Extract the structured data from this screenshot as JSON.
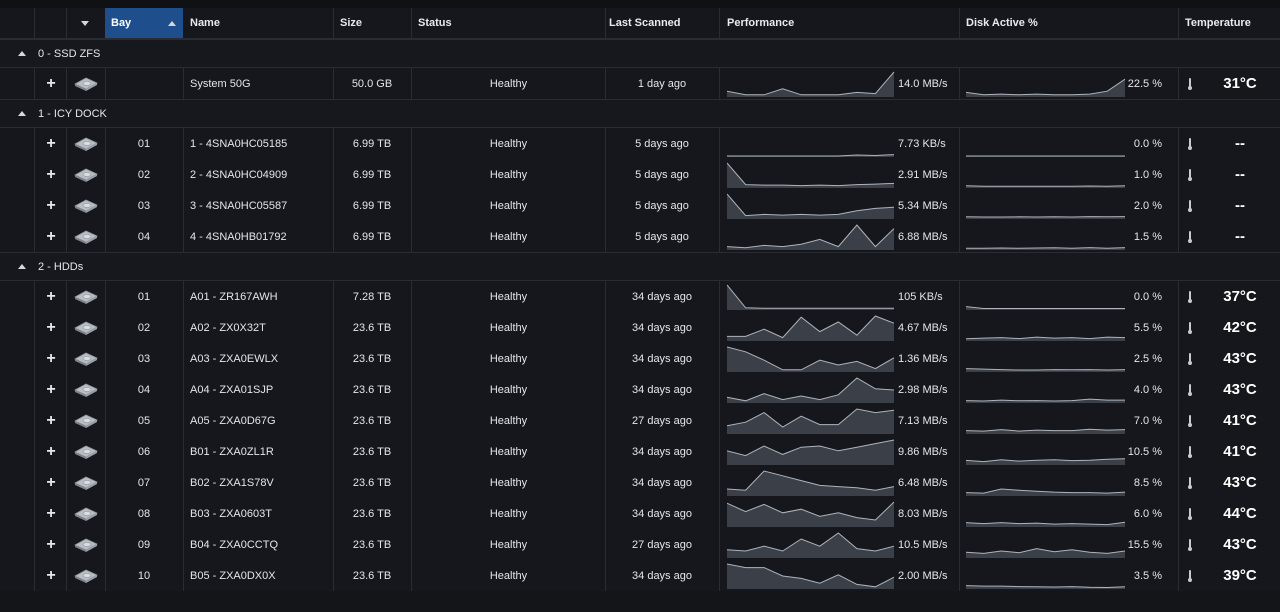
{
  "columns": {
    "bay": "Bay",
    "name": "Name",
    "size": "Size",
    "status": "Status",
    "last_scanned": "Last Scanned",
    "performance": "Performance",
    "disk_active": "Disk Active %",
    "temperature": "Temperature"
  },
  "groups": [
    {
      "label": "0 - SSD ZFS",
      "rows": [
        {
          "bay": "",
          "name": "System 50G",
          "size": "50.0 GB",
          "status": "Healthy",
          "last_scanned": "1 day ago",
          "perf": "14.0 MB/s",
          "active": "22.5 %",
          "temp": "31°C",
          "perf_spark": [
            0.2,
            0.05,
            0.05,
            0.3,
            0.05,
            0.05,
            0.05,
            0.15,
            0.1,
            1.0
          ],
          "active_spark": [
            0.15,
            0.05,
            0.08,
            0.05,
            0.08,
            0.05,
            0.05,
            0.08,
            0.2,
            0.7
          ]
        }
      ]
    },
    {
      "label": "1 - ICY DOCK",
      "rows": [
        {
          "bay": "01",
          "name": "1 - 4SNA0HC05185",
          "size": "6.99 TB",
          "status": "Healthy",
          "last_scanned": "5 days ago",
          "perf": "7.73 KB/s",
          "active": "0.0 %",
          "temp": "--",
          "perf_spark": [
            0,
            0,
            0,
            0,
            0,
            0,
            0,
            0.04,
            0.02,
            0.06
          ],
          "active_spark": [
            0,
            0,
            0,
            0,
            0,
            0,
            0,
            0,
            0,
            0
          ]
        },
        {
          "bay": "02",
          "name": "2 - 4SNA0HC04909",
          "size": "6.99 TB",
          "status": "Healthy",
          "last_scanned": "5 days ago",
          "perf": "2.91 MB/s",
          "active": "1.0 %",
          "temp": "--",
          "perf_spark": [
            1.0,
            0.1,
            0.08,
            0.08,
            0.06,
            0.08,
            0.06,
            0.1,
            0.12,
            0.15
          ],
          "active_spark": [
            0.05,
            0.03,
            0.03,
            0.03,
            0.03,
            0.03,
            0.03,
            0.04,
            0.03,
            0.05
          ]
        },
        {
          "bay": "03",
          "name": "3 - 4SNA0HC05587",
          "size": "6.99 TB",
          "status": "Healthy",
          "last_scanned": "5 days ago",
          "perf": "5.34 MB/s",
          "active": "2.0 %",
          "temp": "--",
          "perf_spark": [
            1.0,
            0.1,
            0.15,
            0.12,
            0.15,
            0.12,
            0.15,
            0.3,
            0.4,
            0.45
          ],
          "active_spark": [
            0.05,
            0.04,
            0.04,
            0.05,
            0.04,
            0.05,
            0.04,
            0.06,
            0.05,
            0.06
          ]
        },
        {
          "bay": "04",
          "name": "4 - 4SNA0HB01792",
          "size": "6.99 TB",
          "status": "Healthy",
          "last_scanned": "5 days ago",
          "perf": "6.88 MB/s",
          "active": "1.5 %",
          "temp": "--",
          "perf_spark": [
            0.1,
            0.05,
            0.15,
            0.1,
            0.2,
            0.4,
            0.1,
            1.0,
            0.1,
            0.85
          ],
          "active_spark": [
            0.03,
            0.03,
            0.04,
            0.03,
            0.04,
            0.05,
            0.03,
            0.06,
            0.03,
            0.06
          ]
        }
      ]
    },
    {
      "label": "2 - HDDs",
      "rows": [
        {
          "bay": "01",
          "name": "A01 - ZR167AWH",
          "size": "7.28 TB",
          "status": "Healthy",
          "last_scanned": "34 days ago",
          "perf": "105 KB/s",
          "active": "0.0 %",
          "temp": "37°C",
          "perf_spark": [
            1.0,
            0.05,
            0.03,
            0.03,
            0.03,
            0.03,
            0.03,
            0.03,
            0.03,
            0.03
          ],
          "active_spark": [
            0.1,
            0.02,
            0.02,
            0.02,
            0.02,
            0.02,
            0.02,
            0.02,
            0.02,
            0.02
          ]
        },
        {
          "bay": "02",
          "name": "A02 - ZX0X32T",
          "size": "23.6 TB",
          "status": "Healthy",
          "last_scanned": "34 days ago",
          "perf": "4.67 MB/s",
          "active": "5.5 %",
          "temp": "42°C",
          "perf_spark": [
            0.15,
            0.15,
            0.45,
            0.1,
            0.95,
            0.35,
            0.75,
            0.2,
            1.0,
            0.7
          ],
          "active_spark": [
            0.05,
            0.08,
            0.1,
            0.06,
            0.12,
            0.08,
            0.1,
            0.06,
            0.12,
            0.1
          ]
        },
        {
          "bay": "03",
          "name": "A03 - ZXA0EWLX",
          "size": "23.6 TB",
          "status": "Healthy",
          "last_scanned": "34 days ago",
          "perf": "1.36 MB/s",
          "active": "2.5 %",
          "temp": "43°C",
          "perf_spark": [
            1.0,
            0.8,
            0.45,
            0.05,
            0.05,
            0.45,
            0.25,
            0.4,
            0.1,
            0.55
          ],
          "active_spark": [
            0.1,
            0.08,
            0.06,
            0.04,
            0.04,
            0.06,
            0.05,
            0.06,
            0.04,
            0.06
          ]
        },
        {
          "bay": "04",
          "name": "A04 - ZXA01SJP",
          "size": "23.6 TB",
          "status": "Healthy",
          "last_scanned": "34 days ago",
          "perf": "2.98 MB/s",
          "active": "4.0 %",
          "temp": "43°C",
          "perf_spark": [
            0.2,
            0.05,
            0.35,
            0.1,
            0.25,
            0.1,
            0.3,
            1.0,
            0.55,
            0.5
          ],
          "active_spark": [
            0.06,
            0.04,
            0.08,
            0.05,
            0.06,
            0.04,
            0.06,
            0.12,
            0.08,
            0.08
          ]
        },
        {
          "bay": "05",
          "name": "A05 - ZXA0D67G",
          "size": "23.6 TB",
          "status": "Healthy",
          "last_scanned": "27 days ago",
          "perf": "7.13 MB/s",
          "active": "7.0 %",
          "temp": "41°C",
          "perf_spark": [
            0.3,
            0.45,
            0.85,
            0.25,
            0.7,
            0.35,
            0.35,
            1.0,
            0.85,
            0.95
          ],
          "active_spark": [
            0.1,
            0.08,
            0.14,
            0.08,
            0.12,
            0.1,
            0.1,
            0.16,
            0.12,
            0.14
          ]
        },
        {
          "bay": "06",
          "name": "B01 - ZXA0ZL1R",
          "size": "23.6 TB",
          "status": "Healthy",
          "last_scanned": "34 days ago",
          "perf": "9.86 MB/s",
          "active": "10.5 %",
          "temp": "41°C",
          "perf_spark": [
            0.55,
            0.35,
            0.75,
            0.4,
            0.7,
            0.75,
            0.55,
            0.7,
            0.85,
            1.0
          ],
          "active_spark": [
            0.15,
            0.1,
            0.18,
            0.12,
            0.16,
            0.18,
            0.14,
            0.16,
            0.2,
            0.22
          ]
        },
        {
          "bay": "07",
          "name": "B02 - ZXA1S78V",
          "size": "23.6 TB",
          "status": "Healthy",
          "last_scanned": "34 days ago",
          "perf": "6.48 MB/s",
          "active": "8.5 %",
          "temp": "43°C",
          "perf_spark": [
            0.25,
            0.2,
            1.0,
            0.8,
            0.6,
            0.4,
            0.35,
            0.3,
            0.2,
            0.35
          ],
          "active_spark": [
            0.1,
            0.08,
            0.25,
            0.2,
            0.16,
            0.12,
            0.1,
            0.1,
            0.08,
            0.12
          ]
        },
        {
          "bay": "08",
          "name": "B03 - ZXA0603T",
          "size": "23.6 TB",
          "status": "Healthy",
          "last_scanned": "34 days ago",
          "perf": "8.03 MB/s",
          "active": "6.0 %",
          "temp": "44°C",
          "perf_spark": [
            0.95,
            0.6,
            0.9,
            0.55,
            0.7,
            0.4,
            0.55,
            0.35,
            0.25,
            1.0
          ],
          "active_spark": [
            0.14,
            0.1,
            0.14,
            0.1,
            0.12,
            0.08,
            0.1,
            0.08,
            0.06,
            0.16
          ]
        },
        {
          "bay": "09",
          "name": "B04 - ZXA0CCTQ",
          "size": "23.6 TB",
          "status": "Healthy",
          "last_scanned": "27 days ago",
          "perf": "10.5 MB/s",
          "active": "15.5 %",
          "temp": "43°C",
          "perf_spark": [
            0.3,
            0.25,
            0.45,
            0.25,
            0.75,
            0.45,
            1.0,
            0.35,
            0.25,
            0.45
          ],
          "active_spark": [
            0.2,
            0.15,
            0.25,
            0.18,
            0.35,
            0.22,
            0.3,
            0.2,
            0.15,
            0.25
          ]
        },
        {
          "bay": "10",
          "name": "B05 - ZXA0DX0X",
          "size": "23.6 TB",
          "status": "Healthy",
          "last_scanned": "34 days ago",
          "perf": "2.00 MB/s",
          "active": "3.5 %",
          "temp": "39°C",
          "perf_spark": [
            1.0,
            0.85,
            0.85,
            0.5,
            0.4,
            0.2,
            0.55,
            0.15,
            0.05,
            0.45
          ],
          "active_spark": [
            0.1,
            0.08,
            0.08,
            0.06,
            0.05,
            0.04,
            0.06,
            0.03,
            0.02,
            0.05
          ]
        }
      ]
    }
  ],
  "colors": {
    "background": "#16171c",
    "sorted_header": "#1e4f8c",
    "spark_fill": "#3a3f48",
    "spark_line": "#aeb4bd"
  },
  "icons": {
    "expand": "plus-icon",
    "drive": "drive-icon",
    "collapse": "triangle-up-icon",
    "sort": "sort-asc-icon",
    "menu": "chevron-down-icon",
    "temperature": "thermometer-icon"
  }
}
